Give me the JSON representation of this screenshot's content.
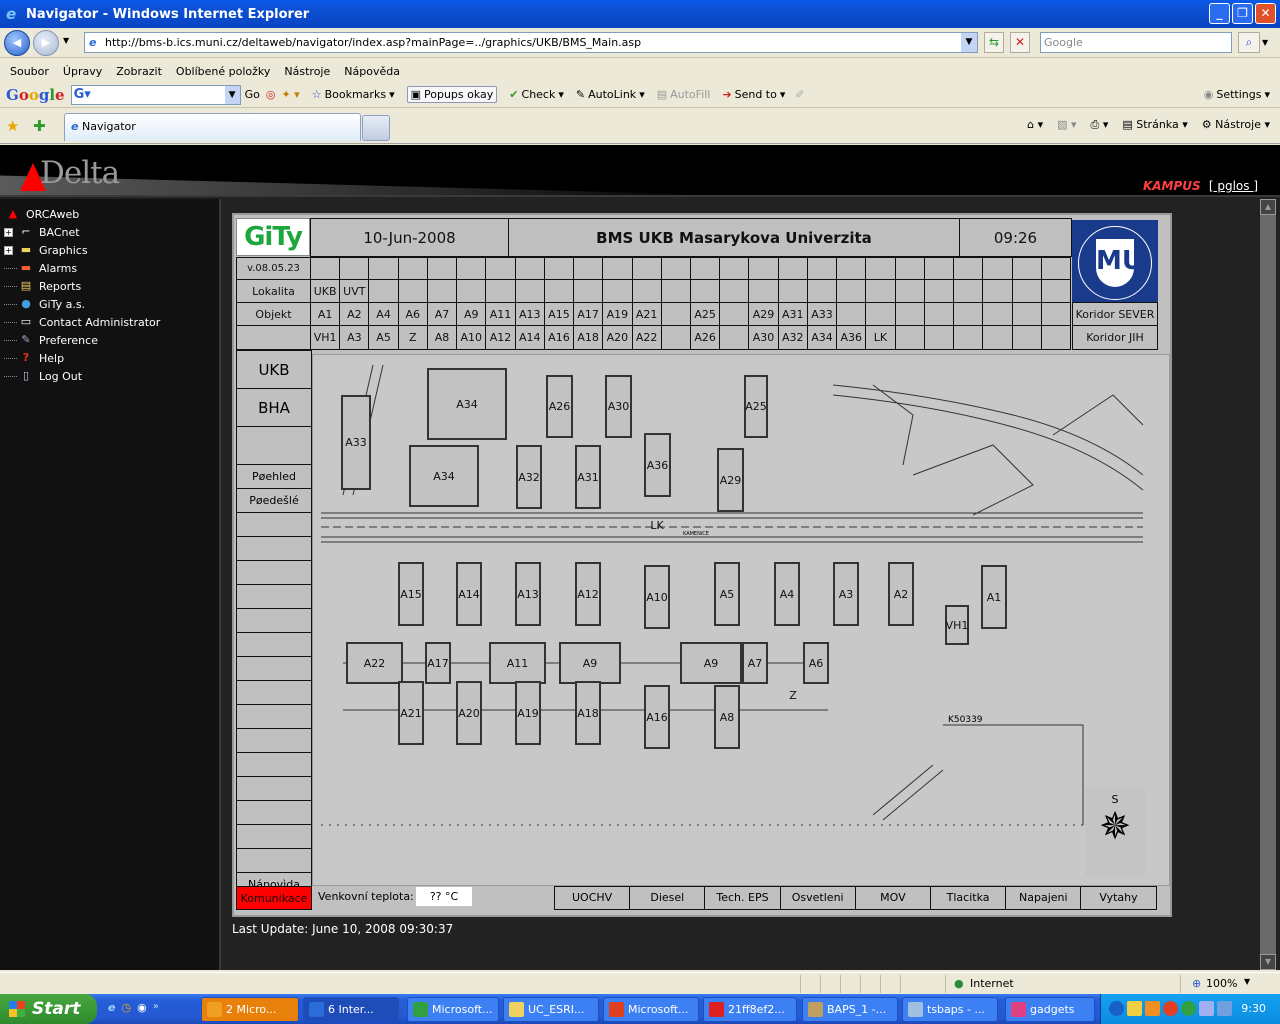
{
  "window": {
    "title": "Navigator - Windows Internet Explorer",
    "buttons": [
      "minimize",
      "restore",
      "close"
    ]
  },
  "address_bar": {
    "url": "http://bms-b.ics.muni.cz/deltaweb/navigator/index.asp?mainPage=../graphics/UKB/BMS_Main.asp",
    "search_placeholder": "Google"
  },
  "menu": [
    "Soubor",
    "Úpravy",
    "Zobrazit",
    "Oblíbené položky",
    "Nástroje",
    "Nápověda"
  ],
  "google_toolbar": {
    "logo": "Google",
    "go": "Go",
    "bookmarks": "Bookmarks",
    "popups": "Popups okay",
    "check": "Check",
    "autolink": "AutoLink",
    "autofill": "AutoFill",
    "sendto": "Send to",
    "settings": "Settings"
  },
  "tabs": [
    {
      "label": "Navigator"
    }
  ],
  "command_bar": {
    "page": "Stránka",
    "tools": "Nástroje"
  },
  "delta_header": {
    "logo": "Delta",
    "site": "KAMPUS",
    "user": "[ pglos ]"
  },
  "tree": [
    {
      "label": "ORCAweb",
      "icon": "delta-icon",
      "expandable": false
    },
    {
      "label": "BACnet",
      "icon": "network-icon",
      "expandable": true
    },
    {
      "label": "Graphics",
      "icon": "folder-icon",
      "expandable": true
    },
    {
      "label": "Alarms",
      "icon": "alarm-folder-icon",
      "expandable": false
    },
    {
      "label": "Reports",
      "icon": "reports-folder-icon",
      "expandable": false
    },
    {
      "label": "GiTy a.s.",
      "icon": "globe-icon",
      "expandable": false
    },
    {
      "label": "Contact Administrator",
      "icon": "contact-card-icon",
      "expandable": false
    },
    {
      "label": "Preference",
      "icon": "preference-icon",
      "expandable": false
    },
    {
      "label": "Help",
      "icon": "help-icon",
      "expandable": false
    },
    {
      "label": "Log Out",
      "icon": "logout-icon",
      "expandable": false
    }
  ],
  "bms": {
    "logo": "GiTy",
    "date": "10-Jun-2008",
    "title": "BMS UKB Masarykova Univerzita",
    "time": "09:26",
    "version": "v.08.05.23",
    "univ_logo": "MU",
    "row_labels": {
      "lokalita": "Lokalita",
      "objekt": "Objekt"
    },
    "lokalita": [
      "UKB",
      "UVT"
    ],
    "objekt_top": [
      "A1",
      "A2",
      "A4",
      "A6",
      "A7",
      "A9",
      "A11",
      "A13",
      "A15",
      "A17",
      "A19",
      "A21",
      "",
      "A25",
      "",
      "A29",
      "A31",
      "A33",
      "",
      "",
      "",
      "",
      "",
      "",
      "",
      ""
    ],
    "objekt_bottom": [
      "VH1",
      "A3",
      "A5",
      "Z",
      "A8",
      "A10",
      "A12",
      "A14",
      "A16",
      "A18",
      "A20",
      "A22",
      "",
      "A26",
      "",
      "A30",
      "A32",
      "A34",
      "A36",
      "LK",
      "",
      "",
      "",
      "",
      "",
      ""
    ],
    "koridor_sever": "Koridor SEVER",
    "koridor_jih": "Koridor JIH",
    "side_buttons": [
      "UKB",
      "BHA",
      "",
      "Pøehled",
      "Pøedešlé",
      "",
      "",
      "",
      "",
      "",
      "",
      "",
      "",
      "",
      "",
      "",
      "",
      "",
      "",
      "",
      "Nápovìda"
    ],
    "komunikace": "Komunikace",
    "temp_label": "Venkovní teplota:",
    "temp_value": "?? °C",
    "bottom_buttons": [
      "UOCHV",
      "Diesel",
      "Tech. EPS",
      "Osvetleni",
      "MOV",
      "Tlacitka",
      "Napajeni",
      "Vytahy"
    ],
    "map": {
      "buildings": [
        "A34",
        "A26",
        "A30",
        "A25",
        "A33",
        "A34",
        "A32",
        "A31",
        "A36",
        "A29",
        "LK",
        "A15",
        "A14",
        "A13",
        "A12",
        "A10",
        "A5",
        "A4",
        "A3",
        "A2",
        "VH1",
        "A1",
        "A22",
        "A17",
        "A11",
        "A9",
        "A9",
        "A7",
        "A6",
        "A21",
        "A20",
        "A19",
        "A18",
        "A16",
        "A8",
        "Z"
      ],
      "compass": "S",
      "road_label": "KAMENICE",
      "parcel": "K50339"
    },
    "last_update": "Last Update: June 10, 2008 09:30:37"
  },
  "status_bar": {
    "zone": "Internet",
    "zoom": "100%"
  },
  "taskbar": {
    "start": "Start",
    "tasks": [
      "2 Micro...",
      "6 Inter...",
      "Microsoft...",
      "UC_ESRI...",
      "Microsoft...",
      "21ff8ef2...",
      "BAPS_1 -...",
      "tsbaps - ...",
      "gadgets"
    ],
    "clock": "9:30"
  }
}
